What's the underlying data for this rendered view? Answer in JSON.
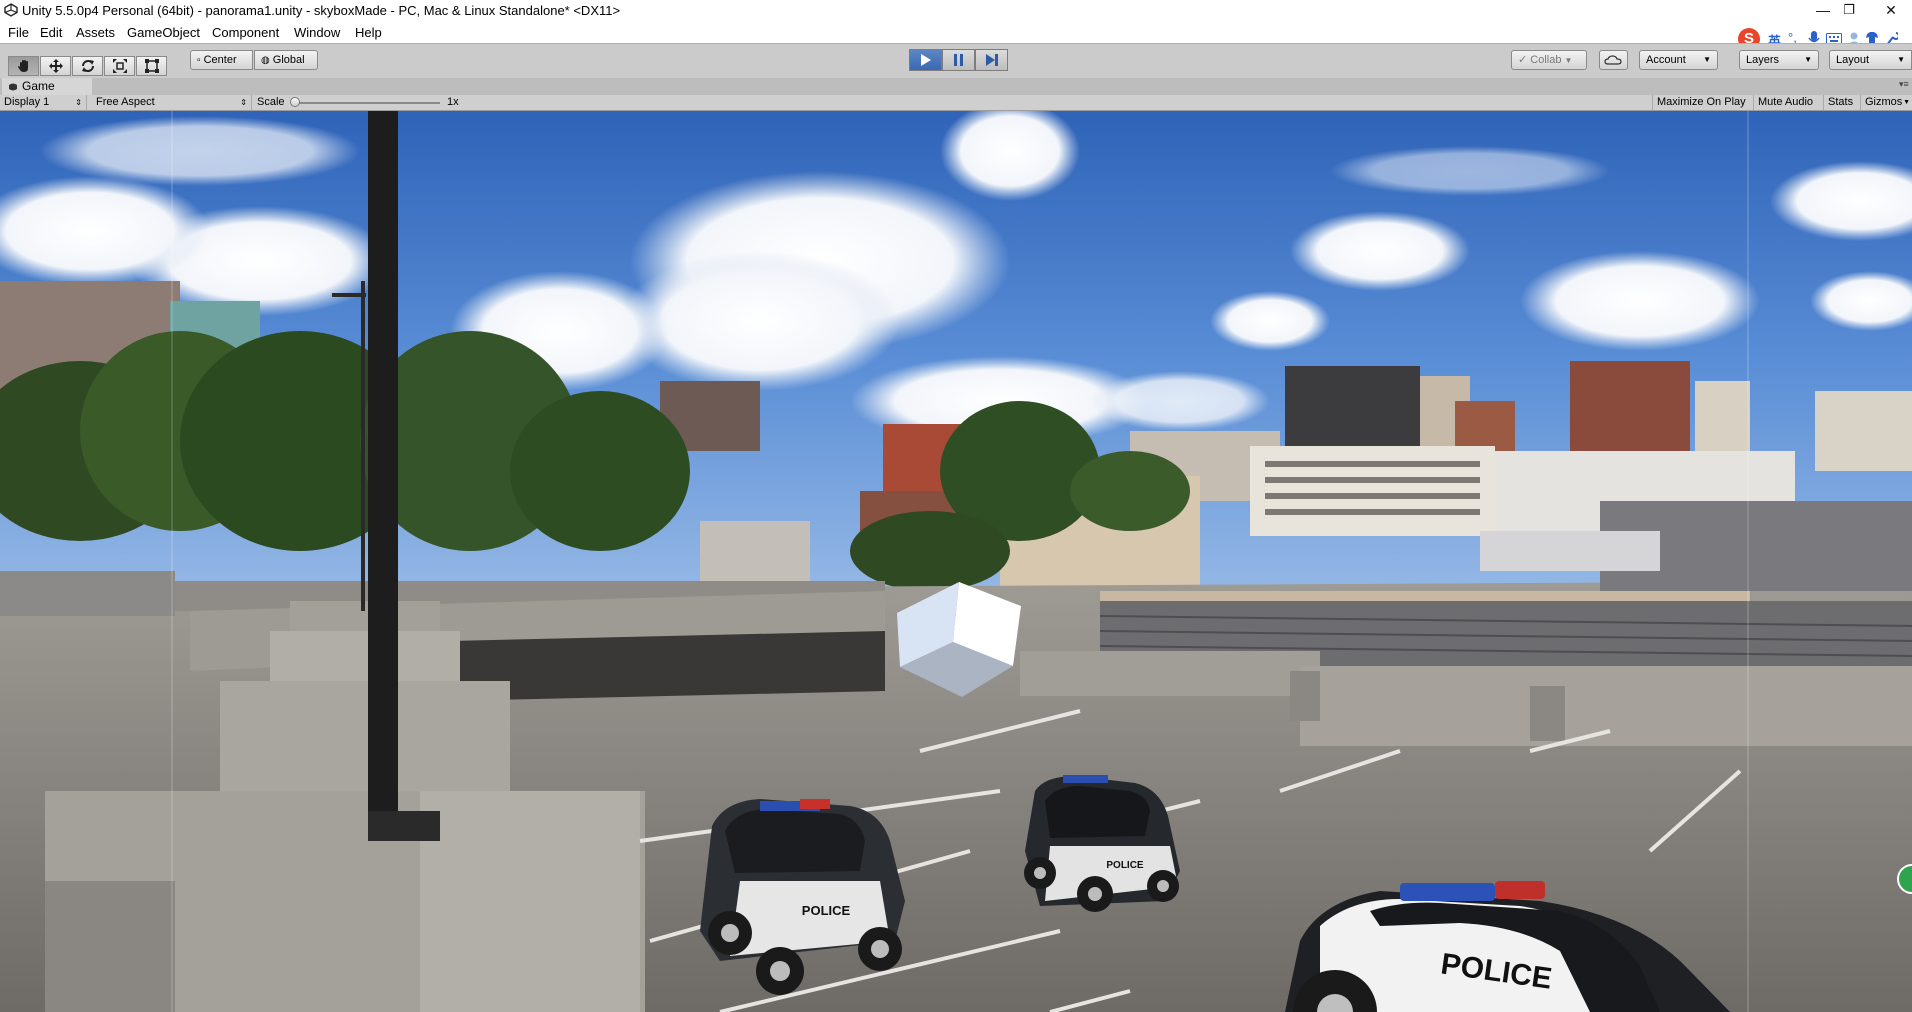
{
  "window": {
    "title": "Unity 5.5.0p4 Personal (64bit) - panorama1.unity - skyboxMade - PC, Mac & Linux Standalone* <DX11>",
    "minimize": "—",
    "maximize": "❐",
    "close": "✕"
  },
  "menu": [
    "File",
    "Edit",
    "Assets",
    "GameObject",
    "Component",
    "Window",
    "Help"
  ],
  "toolbar": {
    "tools": [
      "hand-icon",
      "move-icon",
      "rotate-icon",
      "scale-icon",
      "rect-tool-icon"
    ],
    "pivot": "Center",
    "space": "Global",
    "collab": "Collab",
    "account": "Account",
    "layers": "Layers",
    "layout": "Layout"
  },
  "game_tab": {
    "label": "Game",
    "display": "Display 1",
    "aspect": "Free Aspect",
    "scale_label": "Scale",
    "scale_value": "1x",
    "maximize_on_play": "Maximize On Play",
    "mute_audio": "Mute Audio",
    "stats": "Stats",
    "gizmos": "Gizmos"
  },
  "ime": {
    "lang": "英"
  },
  "scene": {
    "police_label": "POLICE"
  },
  "colors": {
    "play_active": "#3a69b4",
    "toolbar_bg": "#cbcbcb",
    "sky": "#3f74c6"
  }
}
